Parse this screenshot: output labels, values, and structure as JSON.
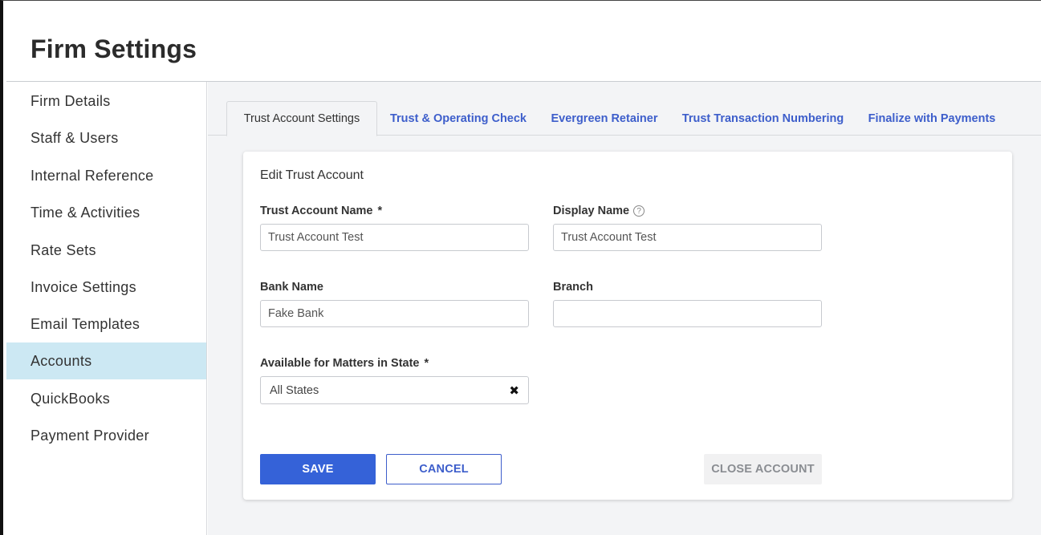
{
  "page": {
    "title": "Firm Settings"
  },
  "sidebar": {
    "items": [
      {
        "label": "Firm Details"
      },
      {
        "label": "Staff & Users"
      },
      {
        "label": "Internal Reference"
      },
      {
        "label": "Time & Activities"
      },
      {
        "label": "Rate Sets"
      },
      {
        "label": "Invoice Settings"
      },
      {
        "label": "Email Templates"
      },
      {
        "label": "Accounts",
        "active": true
      },
      {
        "label": "QuickBooks"
      },
      {
        "label": "Payment Provider"
      }
    ]
  },
  "tabs": [
    {
      "label": "Trust Account Settings",
      "active": true
    },
    {
      "label": "Trust & Operating Check"
    },
    {
      "label": "Evergreen Retainer"
    },
    {
      "label": "Trust Transaction Numbering"
    },
    {
      "label": "Finalize with Payments"
    }
  ],
  "form": {
    "title": "Edit Trust Account",
    "required_marker": "*",
    "help_icon_glyph": "?",
    "trust_account_name": {
      "label": "Trust Account Name",
      "value": "Trust Account Test"
    },
    "display_name": {
      "label": "Display Name",
      "value": "Trust Account Test",
      "icon": "help-circle-icon"
    },
    "bank_name": {
      "label": "Bank Name",
      "value": "Fake Bank"
    },
    "branch": {
      "label": "Branch",
      "value": ""
    },
    "state": {
      "label": "Available for Matters in State",
      "value": "All States",
      "clear_icon": "✖"
    }
  },
  "buttons": {
    "save": "SAVE",
    "cancel": "CANCEL",
    "close_account": "CLOSE ACCOUNT"
  },
  "colors": {
    "accent": "#3562d8",
    "link": "#3d5ecb",
    "active_nav": "#cce8f3",
    "content_bg": "#f3f4f6"
  }
}
